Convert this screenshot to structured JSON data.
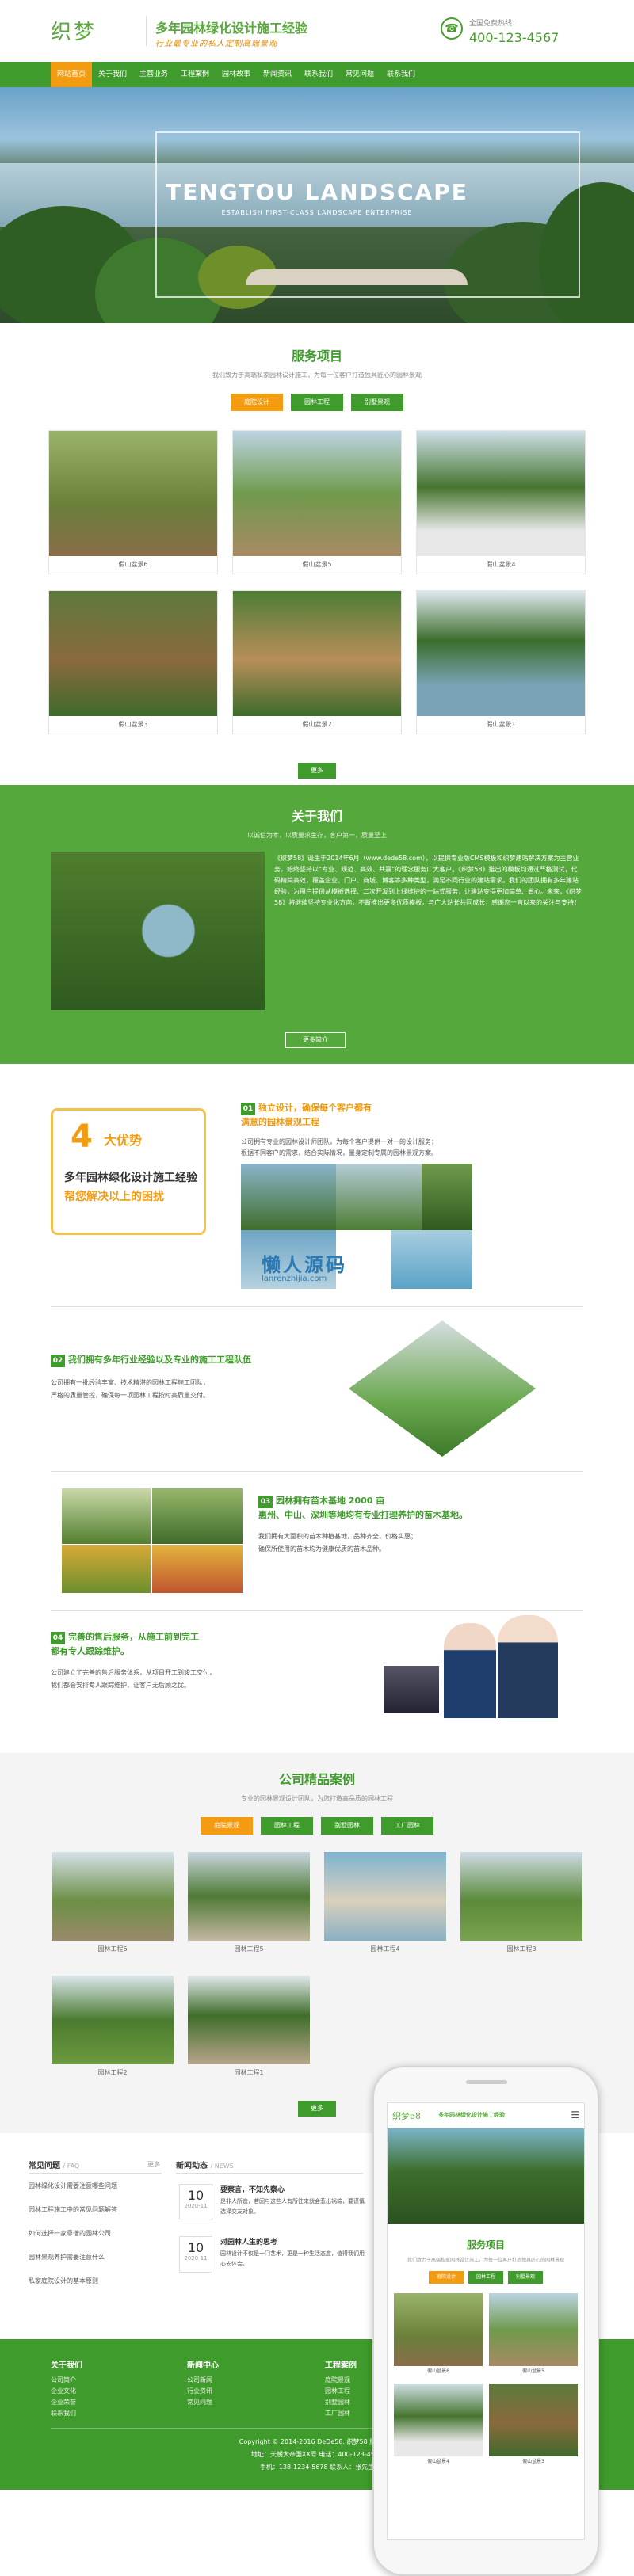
{
  "header": {
    "logo": "织梦",
    "slogan_main": "多年园林绿化设计施工经验",
    "slogan_sub": "行业最专业的私人定制高端景观",
    "phone_label": "全国免费热线：",
    "phone_number": "400-123-4567"
  },
  "nav": [
    "网站首页",
    "关于我们",
    "主营业务",
    "工程案例",
    "园林故事",
    "新闻资讯",
    "联系我们",
    "常见问题",
    "联系我们"
  ],
  "hero": {
    "title": "TENGTOU LANDSCAPE",
    "subtitle": "ESTABLISH FIRST-CLASS LANDSCAPE ENTERPRISE"
  },
  "services": {
    "title": "服务项目",
    "desc": "我们致力于高端私家园林设计施工，为每一位客户打造独具匠心的园林景观",
    "tabs": [
      "庭院设计",
      "园林工程",
      "别墅景观"
    ],
    "items": [
      "假山盆景6",
      "假山盆景5",
      "假山盆景4",
      "假山盆景3",
      "假山盆景2",
      "假山盆景1"
    ],
    "more": "更多"
  },
  "about": {
    "title": "关于我们",
    "desc": "以诚信为本，以质量求生存，客户第一，质量至上",
    "text": "《织梦58》诞生于2014年6月（www.dede58.com），以提供专业版CMS模板和织梦建站解决方案为主营业务，始终坚持以“专业、规范、高效、共赢”的理念服务广大客户。《织梦58》推出的模板均通过严格测试，代码精简高效，覆盖企业、门户、商城、博客等多种类型，满足不同行业的建站需求。我们的团队拥有多年建站经验，为用户提供从模板选择、二次开发到上线维护的一站式服务，让建站变得更加简单、省心。未来，《织梦58》将继续坚持专业化方向，不断推出更多优质模板，与广大站长共同成长，感谢您一直以来的关注与支持！",
    "more": "更多简介"
  },
  "advantages": {
    "badge_num": "4",
    "badge_title": "大优势",
    "badge_line1": "多年园林绿化设计施工经验",
    "badge_line2": "帮您解决以上的困扰",
    "items": [
      {
        "num": "01",
        "head": "独立设计，确保每个客户都有",
        "head2": "满意的园林景观工程",
        "lines": [
          "公司拥有专业的园林设计师团队，为每个客户提供一对一的设计服务；",
          "根据不同客户的需求，结合实际情况，量身定制专属的园林景观方案。"
        ]
      },
      {
        "num": "02",
        "head": "我们拥有多年行业经验以及专业的施工工程队伍",
        "lines": [
          "公司拥有一批经验丰富、技术精湛的园林工程施工团队，",
          "严格的质量管控，确保每一项园林工程按时高质量交付。"
        ]
      },
      {
        "num": "03",
        "head": "园林拥有苗木基地 2000 亩",
        "head2": "惠州、中山、深圳等地均有专业打理养护的苗木基地。",
        "lines": [
          "我们拥有大面积的苗木种植基地，品种齐全，价格实惠；",
          "确保所使用的苗木均为健康优质的苗木品种。"
        ]
      },
      {
        "num": "04",
        "head": "完善的售后服务，从施工前到完工",
        "head2": "都有专人跟踪维护。",
        "lines": [
          "公司建立了完善的售后服务体系，从项目开工到竣工交付，",
          "我们都会安排专人跟踪维护，让客户无后顾之忧。"
        ]
      }
    ],
    "watermark": "懒人源码",
    "watermark_url": "lanrenzhijia.com"
  },
  "cases": {
    "title": "公司精品案例",
    "desc": "专业的园林景观设计团队，为您打造高品质的园林工程",
    "tabs": [
      "庭院景观",
      "园林工程",
      "别墅园林",
      "工厂园林"
    ],
    "items": [
      "园林工程6",
      "园林工程5",
      "园林工程4",
      "园林工程3",
      "园林工程2",
      "园林工程1"
    ],
    "more": "更多"
  },
  "faq": {
    "title": "常见问题",
    "en": "/ FAQ",
    "more": "更多",
    "items": [
      "园林绿化设计需要注意哪些问题",
      "园林工程施工中的常见问题解答",
      "如何选择一家靠谱的园林公司",
      "园林景观养护需要注意什么",
      "私家庭院设计的基本原则"
    ]
  },
  "news": {
    "title": "新闻动态",
    "en": "/ NEWS",
    "items": [
      {
        "day": "10",
        "ym": "2020-11",
        "title": "要察言，不知先察心",
        "text": "是非人所造，若因与这些人有所往来就会惹出祸端，要谨慎选择交友对象。"
      },
      {
        "day": "10",
        "ym": "2020-11",
        "title": "对园林人生的思考",
        "text": "园林设计不仅是一门艺术，更是一种生活态度，值得我们用心去体会。"
      }
    ]
  },
  "footer": {
    "cols": [
      {
        "title": "关于我们",
        "items": [
          "公司简介",
          "企业文化",
          "企业荣誉",
          "联系我们"
        ]
      },
      {
        "title": "新闻中心",
        "items": [
          "公司新闻",
          "行业资讯",
          "常见问题"
        ]
      },
      {
        "title": "工程案例",
        "items": [
          "庭院景观",
          "园林工程",
          "别墅园林",
          "工厂园林"
        ]
      }
    ],
    "copyright": "Copyright © 2014-2016 DeDe58. 织梦58 版权所有",
    "address": "地址：天朝大帝国XX号 电话：400-123-4567",
    "contact": "手机：138-1234-5678 联系人：张先生"
  },
  "mobile": {
    "logo": "织梦58",
    "slogan": "多年园林绿化设计施工经验",
    "title": "服务项目",
    "desc": "我们致力于高端私家园林设计施工，为每一位客户打造独具匠心的园林景观",
    "tabs": [
      "庭院设计",
      "园林工程",
      "别墅景观"
    ],
    "items": [
      "假山盆景6",
      "假山盆景5",
      "假山盆景4",
      "假山盆景3"
    ]
  }
}
